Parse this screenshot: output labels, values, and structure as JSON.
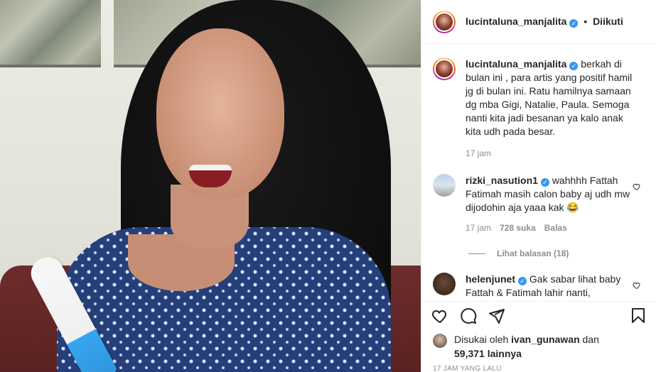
{
  "header": {
    "username": "lucintaluna_manjalita",
    "separator": "•",
    "follow_label": "Diikuti"
  },
  "comments": [
    {
      "username": "lucintaluna_manjalita",
      "text": "berkah di bulan ini , para artis yang positif hamil jg di bulan ini. Ratu hamilnya samaan dg mba Gigi, Natalie, Paula. Semoga nanti kita jadi besanan ya kalo anak kita udh pada besar.",
      "time": "17 jam"
    },
    {
      "username": "rizki_nasution1",
      "text": "wahhhh Fattah Fatimah masih calon baby aj udh mw dijodohin aja yaaa kak 😂",
      "time": "17 jam",
      "likes": "728 suka",
      "reply_label": "Balas",
      "view_replies": "Lihat balasan (18)"
    },
    {
      "username": "helenjunet",
      "text": "Gak sabar lihat baby Fattah & Fatimah lahir nanti,"
    }
  ],
  "likes": {
    "prefix": "Disukai oleh",
    "user": "ivan_gunawan",
    "and": "dan",
    "count": "59,371 lainnya"
  },
  "time_ago": "17 JAM YANG LALU",
  "icons": [
    "heart-icon",
    "comment-icon",
    "share-icon",
    "bookmark-icon",
    "verified-badge-icon"
  ],
  "colors": {
    "verified": "#3897f0",
    "meta": "#8e8e8e",
    "text": "#262626"
  }
}
